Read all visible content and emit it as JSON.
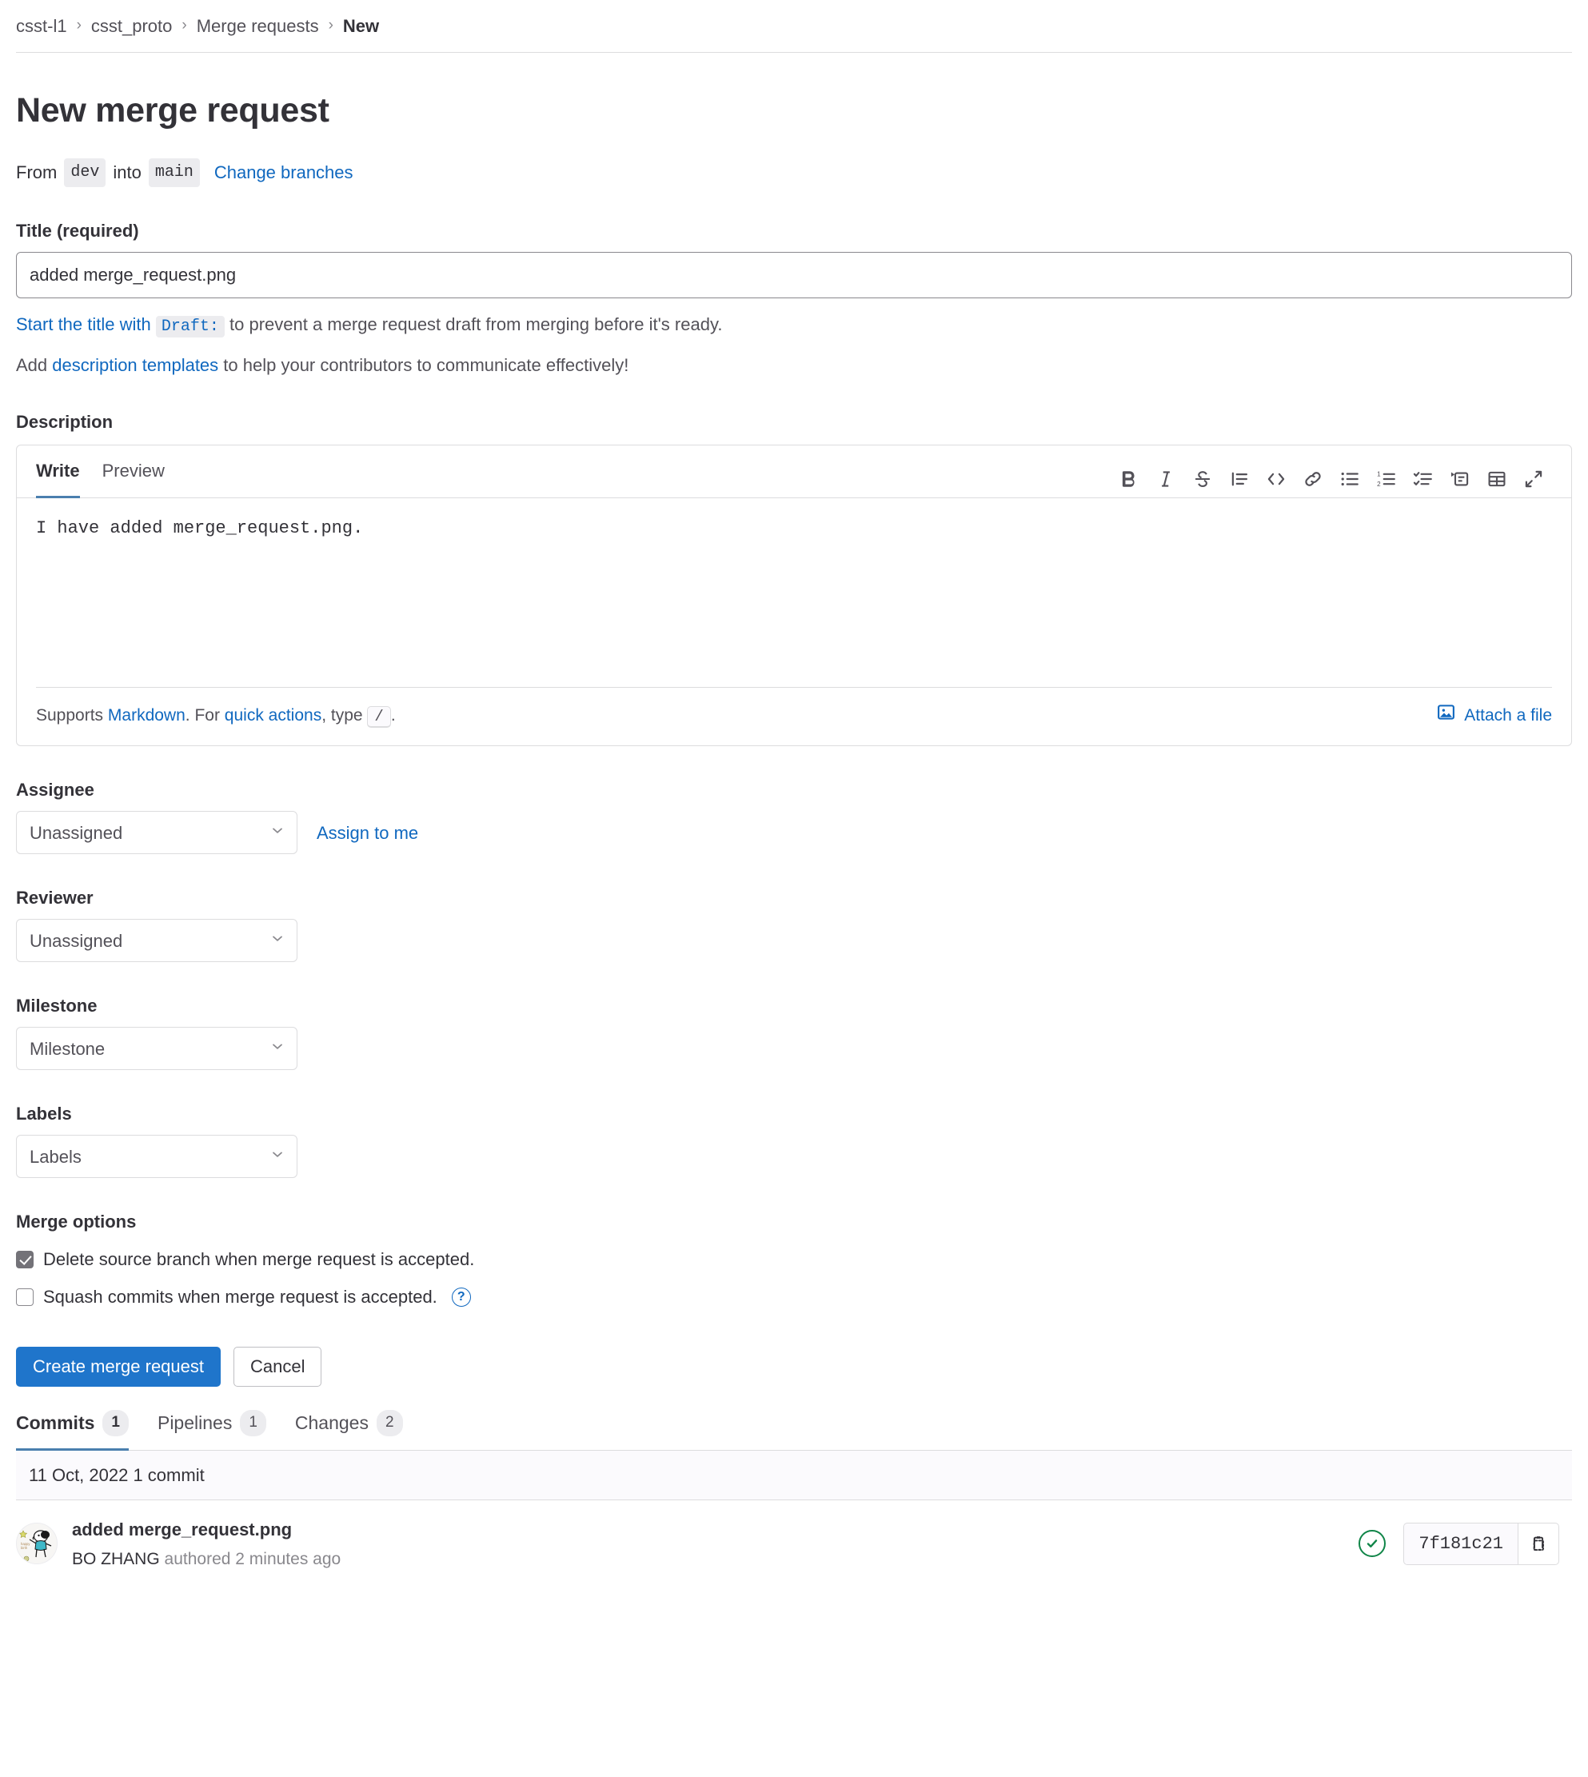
{
  "breadcrumb": {
    "items": [
      {
        "label": "csst-l1",
        "current": false
      },
      {
        "label": "csst_proto",
        "current": false
      },
      {
        "label": "Merge requests",
        "current": false
      },
      {
        "label": "New",
        "current": true
      }
    ],
    "separator": "›"
  },
  "page": {
    "title": "New merge request"
  },
  "branches": {
    "from_label": "From",
    "source": "dev",
    "into_label": "into",
    "target": "main",
    "change_link": "Change branches"
  },
  "title_field": {
    "label": "Title (required)",
    "value": "added merge_request.png",
    "placeholder": "Title"
  },
  "title_hints": {
    "draft_link": "Start the title with",
    "draft_code": "Draft:",
    "draft_rest": "to prevent a merge request draft from merging before it's ready.",
    "templates_prefix": "Add",
    "templates_link": "description templates",
    "templates_rest": "to help your contributors to communicate effectively!"
  },
  "description": {
    "label": "Description",
    "tabs": [
      {
        "label": "Write",
        "active": true
      },
      {
        "label": "Preview",
        "active": false
      }
    ],
    "toolbar": [
      {
        "name": "bold-icon",
        "title": "Bold"
      },
      {
        "name": "italic-icon",
        "title": "Italic"
      },
      {
        "name": "strikethrough-icon",
        "title": "Strikethrough"
      },
      {
        "name": "quote-icon",
        "title": "Insert a quote"
      },
      {
        "name": "code-icon",
        "title": "Insert code"
      },
      {
        "name": "link-icon",
        "title": "Add a link"
      },
      {
        "name": "bulleted-list-icon",
        "title": "Add a bullet list"
      },
      {
        "name": "numbered-list-icon",
        "title": "Add a numbered list"
      },
      {
        "name": "task-list-icon",
        "title": "Add a checklist"
      },
      {
        "name": "collapsible-section-icon",
        "title": "Add a collapsible section"
      },
      {
        "name": "table-icon",
        "title": "Add a table"
      },
      {
        "name": "fullscreen-icon",
        "title": "Go full screen"
      }
    ],
    "text": "I have added merge_request.png.",
    "footer": {
      "supports_prefix": "Supports",
      "markdown_link": "Markdown",
      "middle": ". For",
      "quick_actions_link": "quick actions",
      "type_text": ", type",
      "slash": "/",
      "period": ".",
      "attach_label": "Attach a file"
    }
  },
  "assignee": {
    "label": "Assignee",
    "value": "Unassigned",
    "assign_link": "Assign to me"
  },
  "reviewer": {
    "label": "Reviewer",
    "value": "Unassigned"
  },
  "milestone": {
    "label": "Milestone",
    "value": "Milestone"
  },
  "labels": {
    "label": "Labels",
    "value": "Labels"
  },
  "merge_options": {
    "label": "Merge options",
    "delete_source": {
      "text": "Delete source branch when merge request is accepted.",
      "checked": true
    },
    "squash": {
      "text": "Squash commits when merge request is accepted.",
      "checked": false,
      "help": "?"
    }
  },
  "actions": {
    "submit_label": "Create merge request",
    "cancel_label": "Cancel"
  },
  "tabs": [
    {
      "label": "Commits",
      "count": "1",
      "active": true
    },
    {
      "label": "Pipelines",
      "count": "1",
      "active": false
    },
    {
      "label": "Changes",
      "count": "2",
      "active": false
    }
  ],
  "commits": {
    "date_header": "11 Oct, 2022 1 commit",
    "rows": [
      {
        "title": "added merge_request.png",
        "author": "BO ZHANG",
        "meta": "authored 2 minutes ago",
        "sha": "7f181c21",
        "status": "passed"
      }
    ]
  },
  "colors": {
    "link": "#1068bf",
    "primary_button": "#1f75cb",
    "tab_underline": "#4a7fae",
    "status_success": "#108548",
    "text": "#333238",
    "muted_text": "#535158",
    "border": "#dcdcde"
  }
}
